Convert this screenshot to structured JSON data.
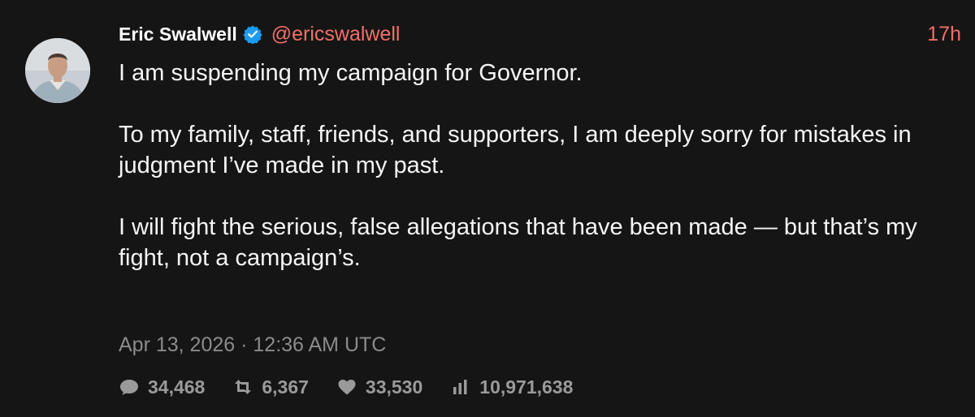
{
  "author": {
    "name": "Eric Swalwell",
    "handle": "@ericswalwell",
    "verified": true
  },
  "time_ago": "17h",
  "body": {
    "paragraphs": [
      "I am suspending my campaign for Governor.",
      "To my family, staff, friends, and supporters, I am deeply sorry for mistakes in judgment I’ve made in my past.",
      "I will fight the serious, false allegations that have been made — but that’s my fight, not a campaign’s."
    ]
  },
  "timestamp": "Apr 13, 2026 · 12:36 AM UTC",
  "stats": {
    "replies": "34,468",
    "retweets": "6,367",
    "likes": "33,530",
    "views": "10,971,638"
  },
  "icons": {
    "replies": "comment-icon",
    "retweets": "retweet-icon",
    "likes": "heart-icon",
    "views": "views-chart-icon",
    "verified": "verified-badge-icon"
  },
  "colors": {
    "background": "#151515",
    "accent": "#f0706a",
    "verified": "#1d9bf0",
    "muted": "#8b8b8b"
  }
}
